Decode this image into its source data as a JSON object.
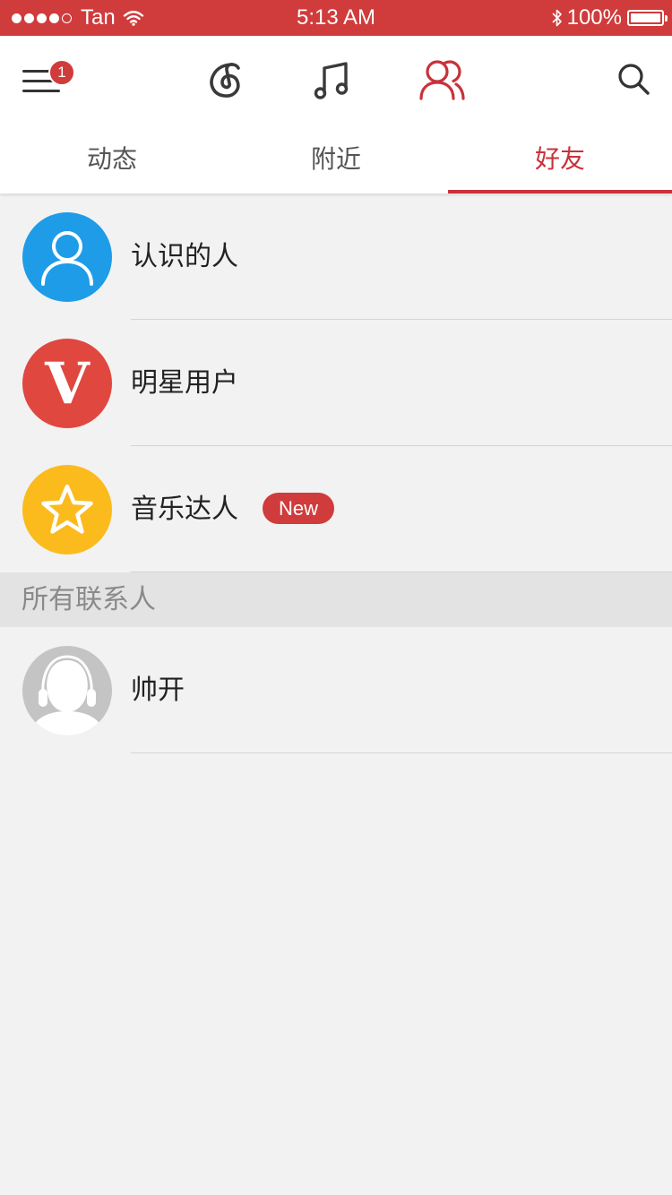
{
  "status_bar": {
    "carrier": "Tan",
    "time": "5:13 AM",
    "battery": "100%",
    "icons": [
      "signal-dots-icon",
      "wifi-icon",
      "bluetooth-icon",
      "battery-icon"
    ]
  },
  "top_nav": {
    "menu_badge": "1",
    "icons": [
      "menu-icon",
      "music-brand-icon",
      "music-note-icon",
      "friends-icon",
      "search-icon"
    ],
    "active_color": "#c8323a"
  },
  "sub_tabs": [
    {
      "label": "动态",
      "active": false
    },
    {
      "label": "附近",
      "active": false
    },
    {
      "label": "好友",
      "active": true
    }
  ],
  "list": {
    "items": [
      {
        "label": "认识的人",
        "icon": "person-icon",
        "color": "#1e9ce8"
      },
      {
        "label": "明星用户",
        "icon": "v-icon",
        "letter": "V",
        "color": "#e0473e"
      },
      {
        "label": "音乐达人",
        "icon": "star-icon",
        "color": "#fbbb1d",
        "badge": "New"
      }
    ],
    "section_title": "所有联系人",
    "contacts": [
      {
        "name": "帅开",
        "icon": "default-avatar-icon"
      }
    ]
  },
  "colors": {
    "brand_red": "#d03b3b",
    "background": "#f2f2f2"
  }
}
